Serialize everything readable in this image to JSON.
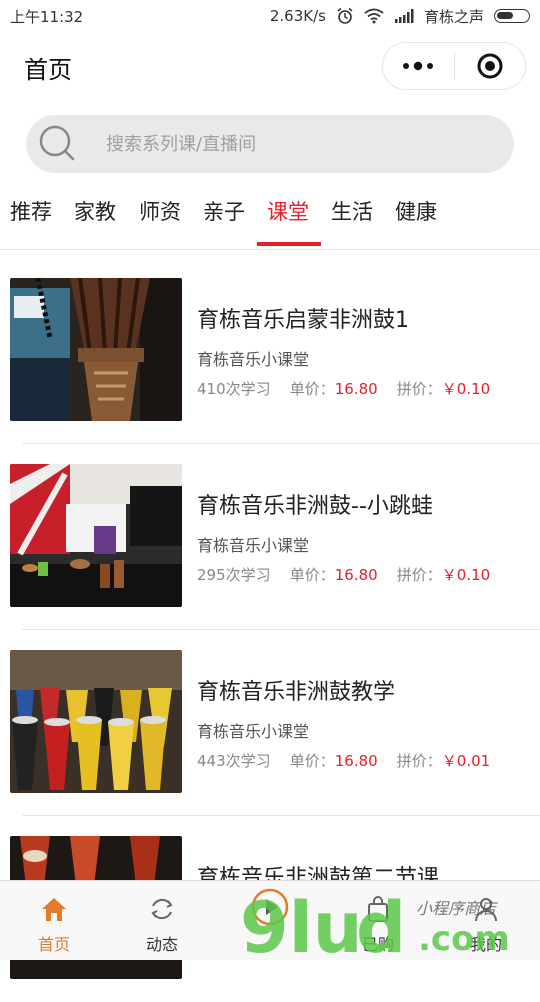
{
  "status_bar": {
    "time": "上午11:32",
    "speed": "2.63K/s",
    "carrier": "育栋之声"
  },
  "navbar": {
    "title": "首页",
    "menu_icon": "more-dots-icon",
    "close_icon": "target-close-icon"
  },
  "search": {
    "placeholder": "搜索系列课/直播间",
    "icon": "search-icon"
  },
  "tabs": [
    {
      "label": "推荐",
      "active": false
    },
    {
      "label": "家教",
      "active": false
    },
    {
      "label": "师资",
      "active": false
    },
    {
      "label": "亲子",
      "active": false
    },
    {
      "label": "课堂",
      "active": true
    },
    {
      "label": "生活",
      "active": false
    },
    {
      "label": "健康",
      "active": false
    }
  ],
  "items": [
    {
      "title": "育栋音乐启蒙非洲鼓1",
      "subtitle": "育栋音乐小课堂",
      "views": "410次学习",
      "price_label": "单价：",
      "price": "16.80",
      "group_label": "拼价：",
      "group_price": "￥0.10"
    },
    {
      "title": "育栋音乐非洲鼓--小跳蛙",
      "subtitle": "育栋音乐小课堂",
      "views": "295次学习",
      "price_label": "单价：",
      "price": "16.80",
      "group_label": "拼价：",
      "group_price": "￥0.10"
    },
    {
      "title": "育栋音乐非洲鼓教学",
      "subtitle": "育栋音乐小课堂",
      "views": "443次学习",
      "price_label": "单价：",
      "price": "16.80",
      "group_label": "拼价：",
      "group_price": "￥0.01"
    },
    {
      "title": "育栋音乐非洲鼓第二节课",
      "subtitle": "",
      "views": "",
      "price_label": "",
      "price": "",
      "group_label": "",
      "group_price": ""
    }
  ],
  "tabbar": [
    {
      "label": "首页",
      "icon": "home-icon",
      "active": true
    },
    {
      "label": "动态",
      "icon": "refresh-icon",
      "active": false
    },
    {
      "label": "",
      "icon": "play-icon",
      "active": false
    },
    {
      "label": "已购",
      "icon": "bag-icon",
      "active": false
    },
    {
      "label": "我的",
      "icon": "person-icon",
      "active": false
    }
  ],
  "watermark": {
    "text": "9lud.com",
    "script": "小程序商店"
  },
  "colors": {
    "accent": "#e5202a",
    "tab_active": "#e47b2b",
    "search_bg": "#e9e9e9"
  }
}
